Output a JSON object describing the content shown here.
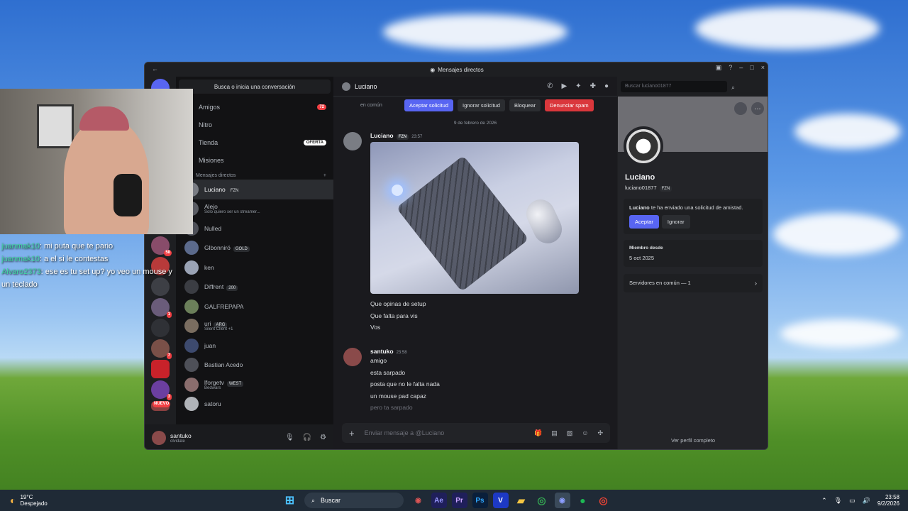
{
  "window": {
    "title": "Mensajes directos"
  },
  "dm_sidebar": {
    "search": "Busca o inicia una conversación",
    "nav": [
      {
        "label": "Amigos",
        "badge": "72"
      },
      {
        "label": "Nitro",
        "badge": ""
      },
      {
        "label": "Tienda",
        "badge": "OFERTA"
      },
      {
        "label": "Misiones",
        "badge": ""
      }
    ],
    "section": "Mensajes directos",
    "dms": [
      {
        "name": "Luciano",
        "tag": "FZN",
        "sub": "",
        "color": "#7a7d84"
      },
      {
        "name": "Alejo",
        "tag": "",
        "sub": "Solo quiero ser un streamer...",
        "color": "#5a5c63"
      },
      {
        "name": "Nulled",
        "tag": "",
        "sub": "",
        "color": "#4e5058"
      },
      {
        "name": "Glbonnirö",
        "tag": "GOLD",
        "sub": "",
        "color": "#5b6a8c"
      },
      {
        "name": "ken",
        "tag": "",
        "sub": "",
        "color": "#9aa3b5"
      },
      {
        "name": "Diffrent",
        "tag": "200",
        "sub": "",
        "color": "#3b3d43"
      },
      {
        "name": "GALFREPAPA",
        "tag": "",
        "sub": "",
        "color": "#6b7f5a"
      },
      {
        "name": "uri",
        "tag": "ARG",
        "sub": "Silent Client +1",
        "color": "#7a6d60"
      },
      {
        "name": "juan",
        "tag": "",
        "sub": "",
        "color": "#3d4a6e"
      },
      {
        "name": "Bastian Acedo",
        "tag": "",
        "sub": "",
        "color": "#4e5058"
      },
      {
        "name": "lforgetv",
        "tag": "WEST",
        "sub": "Bedwars",
        "color": "#8a6d6d"
      },
      {
        "name": "satoru",
        "tag": "",
        "sub": "",
        "color": "#b0b3b8"
      }
    ]
  },
  "user_panel": {
    "name": "santuko",
    "status": "olvidate"
  },
  "chat": {
    "header_name": "Luciano",
    "search_placeholder": "Buscar luciano01877",
    "request_actions": [
      "Aceptar solicitud",
      "Ignorar solicitud",
      "Bloquear",
      "Denunciar spam"
    ],
    "mutual_text": "en común",
    "date_divider": "9 de febrero de 2026",
    "messages": [
      {
        "author": "Luciano",
        "tag": "FZN",
        "time": "23:57",
        "lines": [
          "Que opinas de setup",
          "Que falta para vis",
          "Vos"
        ]
      },
      {
        "author": "santuko",
        "time": "23:58",
        "lines": [
          "amigo",
          "esta sarpado",
          "posta que no le falta nada",
          "un mouse pad capaz",
          "pero ta sarpado"
        ]
      }
    ],
    "composer_placeholder": "Enviar mensaje a @Luciano"
  },
  "profile": {
    "name": "Luciano",
    "username": "luciano01877",
    "tag": "FZN",
    "request_text": "te ha enviado una solicitud de amistad.",
    "accept": "Aceptar",
    "ignore": "Ignorar",
    "member_since_label": "Miembro desde",
    "member_since": "5 oct 2025",
    "servers": "Servidores en común — 1",
    "view_full": "Ver perfil completo"
  },
  "stream_chat": [
    {
      "user": "juanmak10",
      "text": ": mi puta que te pario"
    },
    {
      "user": "juanmak10",
      "text": ": a el si le contestas"
    },
    {
      "user": "Alvaro2373",
      "text": ": ese es tu set up? yo veo un mouse y un teclado"
    }
  ],
  "guild_badges": [
    "58",
    "1",
    "7",
    "3",
    "NUEVO"
  ],
  "taskbar": {
    "weather_temp": "19°C",
    "weather_desc": "Despejado",
    "search": "Buscar",
    "time": "23:58",
    "date": "9/2/2026",
    "apps": [
      "Ae",
      "Pr",
      "Ps",
      "V"
    ]
  }
}
